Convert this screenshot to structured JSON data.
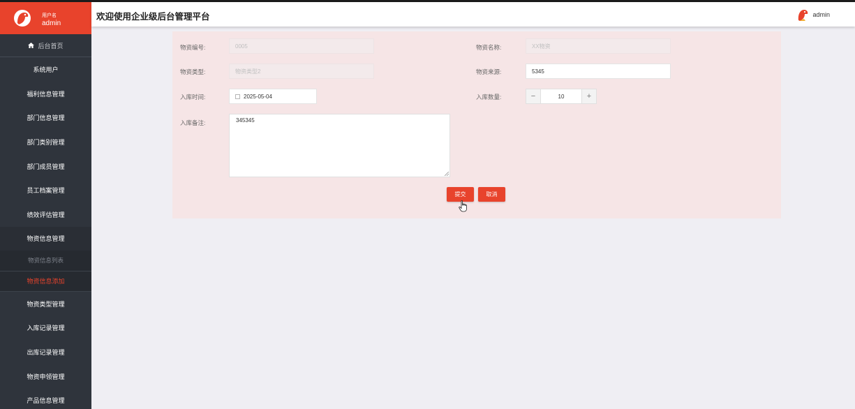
{
  "sidebar": {
    "user_label": "用户名",
    "username": "admin",
    "home": "后台首页",
    "items_top": [
      "系统用户",
      "福利信息管理",
      "部门信息管理",
      "部门类别管理",
      "部门成员管理",
      "员工档案管理",
      "绩效评估管理"
    ],
    "active_parent": "物资信息管理",
    "sub_items": [
      "物资信息列表",
      "物资信息添加"
    ],
    "items_bottom": [
      "物资类型管理",
      "入库记录管理",
      "出库记录管理",
      "物资申领管理",
      "产品信息管理"
    ],
    "accent_color": "#e8432c"
  },
  "header": {
    "title": "欢迎使用企业级后台管理平台",
    "user": "admin"
  },
  "form": {
    "code_label": "物资编号:",
    "code_value": "0005",
    "name_label": "物资名称:",
    "name_value": "XX物资",
    "type_label": "物资类型:",
    "type_value": "物资类型2",
    "source_label": "物资来源:",
    "source_value": "5345",
    "time_label": "入库时间:",
    "time_value": "2025-05-04",
    "qty_label": "入库数量:",
    "qty_value": "10",
    "qty_minus": "−",
    "qty_plus": "+",
    "note_label": "入库备注:",
    "note_value": "345345",
    "submit": "提交",
    "cancel": "取消"
  }
}
